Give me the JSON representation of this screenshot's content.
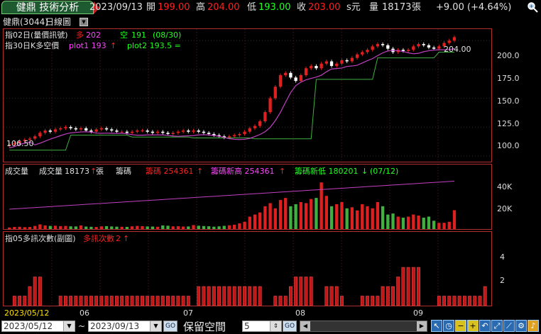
{
  "titlebar": {
    "app_tab": "健鼎 技術分析",
    "stock": "健鼎(3044)",
    "period": "日線圖",
    "date": "2023/09/13",
    "open_label": "開",
    "open": "199.00",
    "high_label": "高",
    "high": "204.00",
    "low_label": "低",
    "low": "193.00",
    "close_label": "收",
    "close": "203.00",
    "unit": "s元",
    "volume_label": "量",
    "volume": "18173",
    "volume_unit": "張",
    "change": "+9.00 (+4.64%)"
  },
  "price_panel": {
    "line1_name": "指02日(量價訊號)",
    "long_label": "多",
    "long_val": "202",
    "short_label": "空",
    "short_val": "191",
    "ratio": "(08/30)",
    "line2_name": "指30日K多空價",
    "plot1": "plot1 193",
    "plot2": "plot2 193.5 =",
    "high_marker": "204.00",
    "low_marker": "106.50",
    "yticks": [
      "200.0",
      "175.0",
      "150.0",
      "125.0",
      "100.0"
    ]
  },
  "volume_panel": {
    "name": "成交量",
    "vol_label": "成交量",
    "vol_val": "18173",
    "vol_unit": "張",
    "chips_label": "籌碼",
    "chips": "籌碼 254361",
    "chips_high": "籌碼新高 254361",
    "chips_low": "籌碼新低 180201",
    "chips_low_ratio": "(07/12)",
    "yticks": [
      "40K",
      "20K"
    ]
  },
  "signal_panel": {
    "name": "指05多訊次數(副圖)",
    "label": "多訊次數",
    "value": "2",
    "yticks": [
      "4",
      "2"
    ]
  },
  "xaxis": {
    "labels": [
      "2023/05/12",
      "06",
      "07",
      "08",
      "09"
    ]
  },
  "toolbar": {
    "start_date": "2023/05/12",
    "tilde": "~",
    "end_date": "2023/09/13",
    "go": "GO",
    "reserve_label": "保留空間",
    "reserve_val": "5",
    "go2": "GO"
  },
  "colors": {
    "up": "#e02020",
    "down": "#20c020",
    "panel_border": "#b03030",
    "ma_purple": "#c040c0",
    "ma_green": "#40b040"
  },
  "chart_data": {
    "type": "candlestick",
    "y_range": [
      95,
      210
    ],
    "closes": [
      110,
      111,
      113,
      114,
      115,
      117,
      120,
      122,
      121,
      123,
      124,
      125,
      124,
      123,
      124,
      122,
      121,
      123,
      124,
      123,
      122,
      121,
      121,
      120,
      121,
      122,
      122,
      121,
      120,
      121,
      120,
      119,
      120,
      121,
      122,
      121,
      122,
      121,
      120,
      119,
      118,
      117,
      116,
      117,
      118,
      119,
      121,
      124,
      126,
      130,
      138,
      150,
      160,
      170,
      172,
      168,
      165,
      170,
      176,
      178,
      176,
      180,
      182,
      178,
      180,
      183,
      182,
      185,
      188,
      190,
      192,
      195,
      197,
      196,
      193,
      190,
      192,
      191,
      192,
      195,
      197,
      196,
      194,
      193,
      195,
      198,
      200,
      203
    ],
    "volumes": [
      1500,
      2000,
      2200,
      1800,
      2000,
      3000,
      4500,
      3500,
      3000,
      3200,
      2800,
      3000,
      2600,
      2500,
      3500,
      2400,
      2200,
      2000,
      2600,
      2800,
      2500,
      2300,
      2200,
      2100,
      2600,
      3000,
      2800,
      2500,
      2400,
      2200,
      3500,
      3200,
      2600,
      2700,
      2400,
      2500,
      3800,
      3200,
      2900,
      2700,
      2300,
      2600,
      3100,
      3600,
      4200,
      5500,
      7000,
      12000,
      14000,
      16000,
      22000,
      25000,
      20000,
      28000,
      30000,
      22000,
      24000,
      26000,
      25000,
      29000,
      30000,
      45000,
      32000,
      22000,
      24000,
      26000,
      20000,
      21000,
      18000,
      24000,
      22000,
      20000,
      26000,
      22000,
      14000,
      15000,
      12000,
      11000,
      12000,
      14000,
      13000,
      11000,
      12000,
      8000,
      6000,
      6000,
      7000,
      18173
    ],
    "signals": [
      0,
      1,
      1,
      1,
      2,
      3,
      3,
      0,
      0,
      0,
      1,
      1,
      1,
      1,
      1,
      1,
      1,
      1,
      1,
      1,
      1,
      1,
      1,
      1,
      1,
      1,
      1,
      1,
      1,
      1,
      1,
      1,
      1,
      1,
      1,
      1,
      0,
      2,
      2,
      2,
      2,
      2,
      2,
      2,
      2,
      2,
      2,
      2,
      2,
      2,
      0,
      0,
      1,
      1,
      1,
      2,
      3,
      3,
      3,
      3,
      0,
      0,
      2,
      2,
      2,
      1,
      0,
      0,
      0,
      1,
      1,
      1,
      1,
      2,
      2,
      2,
      3,
      4,
      4,
      4,
      4,
      0,
      0,
      0,
      1,
      1,
      1,
      1,
      1,
      1,
      1,
      1,
      1,
      2
    ]
  }
}
